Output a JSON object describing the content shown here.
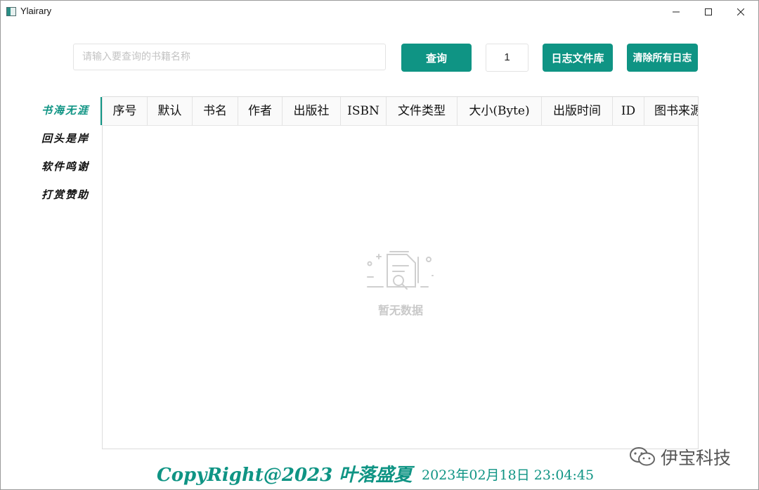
{
  "window": {
    "title": "Ylairary",
    "controls": [
      "minimize-icon",
      "maximize-icon",
      "close-icon"
    ]
  },
  "toolbar": {
    "search_placeholder": "请输入要查询的书籍名称",
    "search_value": "",
    "query_label": "查询",
    "page_number": "1",
    "log_library_label": "日志文件库",
    "clear_logs_label": "清除所有日志"
  },
  "sidebar": {
    "items": [
      {
        "label": "书海无涯",
        "active": true
      },
      {
        "label": "回头是岸",
        "active": false
      },
      {
        "label": "软件鸣谢",
        "active": false
      },
      {
        "label": "打赏赞助",
        "active": false
      }
    ]
  },
  "table": {
    "columns": [
      "序号",
      "默认",
      "书名",
      "作者",
      "出版社",
      "ISBN",
      "文件类型",
      "大小(Byte)",
      "出版时间",
      "ID",
      "图书来源"
    ],
    "rows": [],
    "empty_text": "暂无数据",
    "empty_icon": "empty-document-search-icon"
  },
  "footer": {
    "copyright": "CopyRight@2023 叶落盛夏",
    "datetime": "2023年02月18日 23:04:45"
  },
  "watermark": {
    "icon": "wechat-icon",
    "text": "伊宝科技"
  },
  "colors": {
    "accent": "#0f9484",
    "empty_gray": "#c9c9c9",
    "border": "#dcdcdc"
  }
}
